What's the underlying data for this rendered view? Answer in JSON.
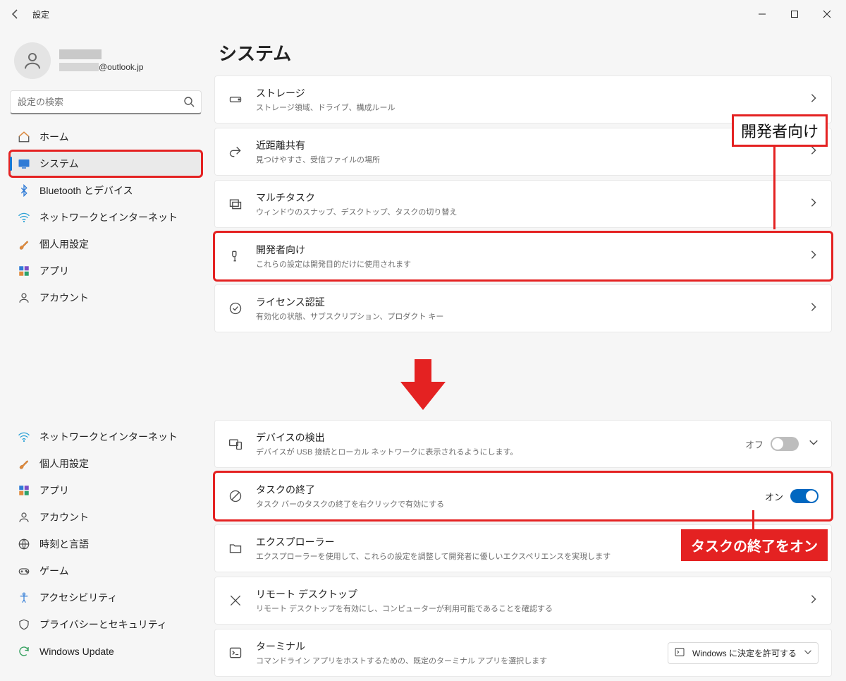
{
  "app": {
    "title": "設定"
  },
  "account": {
    "email_suffix": "@outlook.jp"
  },
  "search": {
    "placeholder": "設定の検索"
  },
  "nav1": {
    "home": "ホーム",
    "system": "システム",
    "bluetooth": "Bluetooth とデバイス",
    "network": "ネットワークとインターネット",
    "personal": "個人用設定",
    "apps": "アプリ",
    "accounts": "アカウント"
  },
  "page1": {
    "title": "システム",
    "rows": {
      "storage": {
        "title": "ストレージ",
        "sub": "ストレージ領域、ドライブ、構成ルール"
      },
      "nearby": {
        "title": "近距離共有",
        "sub": "見つけやすさ、受信ファイルの場所"
      },
      "multitask": {
        "title": "マルチタスク",
        "sub": "ウィンドウのスナップ、デスクトップ、タスクの切り替え"
      },
      "developer": {
        "title": "開発者向け",
        "sub": "これらの設定は開発目的だけに使用されます"
      },
      "license": {
        "title": "ライセンス認証",
        "sub": "有効化の状態、サブスクリプション、プロダクト キー"
      }
    },
    "callout": "開発者向け"
  },
  "nav2": {
    "network": "ネットワークとインターネット",
    "personal": "個人用設定",
    "apps": "アプリ",
    "accounts": "アカウント",
    "time": "時刻と言語",
    "game": "ゲーム",
    "accessibility": "アクセシビリティ",
    "privacy": "プライバシーとセキュリティ",
    "update": "Windows Update"
  },
  "page2": {
    "rows": {
      "device": {
        "title": "デバイスの検出",
        "sub": "デバイスが USB 接続とローカル ネットワークに表示されるようにします。",
        "state": "オフ"
      },
      "endtask": {
        "title": "タスクの終了",
        "sub": "タスク バーのタスクの終了を右クリックで有効にする",
        "state": "オン"
      },
      "explorer": {
        "title": "エクスプローラー",
        "sub": "エクスプローラーを使用して、これらの設定を調整して開発者に優しいエクスペリエンスを実現します"
      },
      "remote": {
        "title": "リモート デスクトップ",
        "sub": "リモート デスクトップを有効にし、コンピューターが利用可能であることを確認する"
      },
      "terminal": {
        "title": "ターミナル",
        "sub": "コマンドライン アプリをホストするための、既定のターミナル アプリを選択します",
        "dropdown": "Windows に決定を許可する"
      }
    },
    "callout": "タスクの終了をオン"
  }
}
